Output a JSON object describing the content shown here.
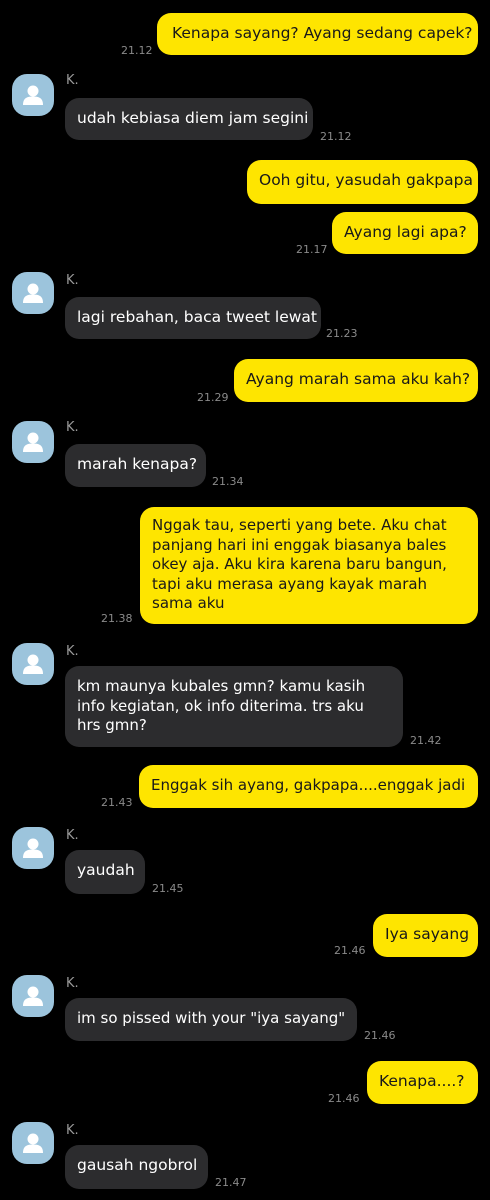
{
  "chat": {
    "contact_name": "K.",
    "colors": {
      "background": "#000000",
      "outgoing_bubble": "#fee500",
      "incoming_bubble": "#2c2c2e",
      "avatar": "#9cc4dc"
    },
    "messages": [
      {
        "from": "me",
        "text": "Kenapa sayang? Ayang sedang capek?",
        "time": "21.12"
      },
      {
        "from": "them",
        "sender": "K.",
        "text": "udah kebiasa diem jam segini",
        "time": "21.12"
      },
      {
        "from": "me",
        "text": "Ooh gitu, yasudah gakpapa",
        "time": ""
      },
      {
        "from": "me",
        "text": "Ayang lagi apa?",
        "time": "21.17"
      },
      {
        "from": "them",
        "sender": "K.",
        "text": "lagi rebahan, baca tweet lewat",
        "time": "21.23"
      },
      {
        "from": "me",
        "text": "Ayang marah sama aku kah?",
        "time": "21.29"
      },
      {
        "from": "them",
        "sender": "K.",
        "text": "marah kenapa?",
        "time": "21.34"
      },
      {
        "from": "me",
        "text": "Nggak tau, seperti yang bete. Aku chat panjang hari ini enggak biasanya bales okey aja. Aku kira karena baru bangun, tapi aku merasa ayang kayak marah sama aku",
        "time": "21.38"
      },
      {
        "from": "them",
        "sender": "K.",
        "text": "km maunya kubales gmn? kamu kasih info kegiatan, ok info diterima. trs aku hrs gmn?",
        "time": "21.42"
      },
      {
        "from": "me",
        "text": "Enggak sih ayang, gakpapa....enggak jadi",
        "time": "21.43"
      },
      {
        "from": "them",
        "sender": "K.",
        "text": "yaudah",
        "time": "21.45"
      },
      {
        "from": "me",
        "text": "Iya sayang",
        "time": "21.46"
      },
      {
        "from": "them",
        "sender": "K.",
        "text": "im so pissed with your \"iya sayang\"",
        "time": "21.46"
      },
      {
        "from": "me",
        "text": "Kenapa....?",
        "time": "21.46"
      },
      {
        "from": "them",
        "sender": "K.",
        "text": "gausah ngobrol",
        "time": "21.47"
      }
    ]
  }
}
